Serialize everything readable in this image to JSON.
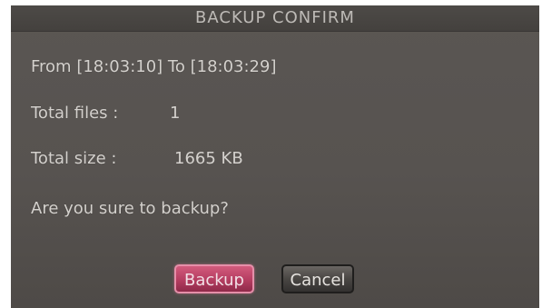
{
  "dialog": {
    "title": "BACKUP CONFIRM",
    "range_text": "From [18:03:10] To [18:03:29]",
    "total_files_label": "Total files :",
    "total_files_value": "1",
    "total_size_label": "Total size :",
    "total_size_value": "1665 KB",
    "question": "Are you sure to backup?",
    "buttons": {
      "backup_label": "Backup",
      "cancel_label": "Cancel"
    }
  },
  "colors": {
    "dialog_bg": "#5b5754",
    "text": "#d4d1cd",
    "backup_button": "#b83f63",
    "cancel_button": "#494643"
  }
}
